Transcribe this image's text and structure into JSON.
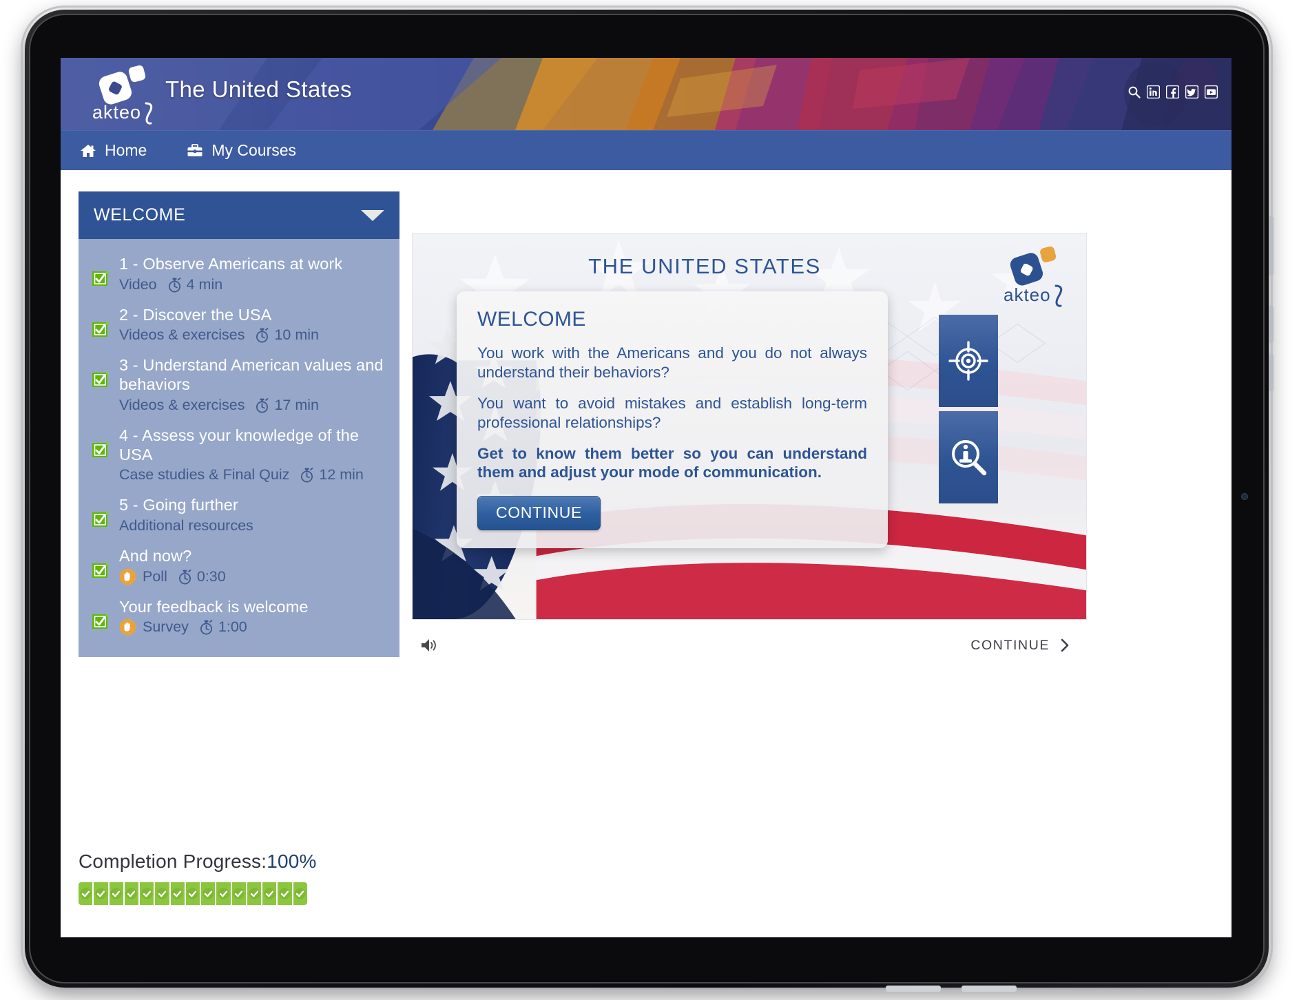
{
  "header": {
    "title": "The United States",
    "brand": "akteos",
    "social": [
      {
        "name": "search-icon",
        "label": "Search"
      },
      {
        "name": "linkedin-icon",
        "label": "LinkedIn"
      },
      {
        "name": "facebook-icon",
        "label": "Facebook"
      },
      {
        "name": "twitter-icon",
        "label": "Twitter"
      },
      {
        "name": "youtube-icon",
        "label": "YouTube"
      }
    ]
  },
  "nav": {
    "items": [
      {
        "label": "Home",
        "icon": "home-icon"
      },
      {
        "label": "My Courses",
        "icon": "briefcase-icon"
      }
    ]
  },
  "sidebar": {
    "section_title": "WELCOME",
    "caret": "chevron-down-icon",
    "items": [
      {
        "name": "1 - Observe Americans at work",
        "type": "Video",
        "duration": "4 min",
        "status": "completed",
        "badge": null
      },
      {
        "name": "2 - Discover the USA",
        "type": "Videos & exercises",
        "duration": "10 min",
        "status": "completed",
        "badge": null
      },
      {
        "name": "3 - Understand American values and behaviors",
        "type": "Videos & exercises",
        "duration": "17 min",
        "status": "completed",
        "badge": null
      },
      {
        "name": "4 - Assess your knowledge of the USA",
        "type": "Case studies & Final Quiz",
        "duration": "12 min",
        "status": "completed",
        "badge": null
      },
      {
        "name": "5 - Going further",
        "type": "Additional resources",
        "duration": "",
        "status": "completed",
        "badge": null
      },
      {
        "name": "And now?",
        "type": "Poll",
        "duration": "0:30",
        "status": "completed",
        "badge": "hand-icon"
      },
      {
        "name": "Your feedback is welcome",
        "type": "Survey",
        "duration": "1:00",
        "status": "completed",
        "badge": "hand-icon"
      }
    ]
  },
  "slide": {
    "title": "THE UNITED STATES",
    "logo": "akteos",
    "panels": [
      {
        "name": "objectives-panel",
        "icon": "target-icon"
      },
      {
        "name": "information-panel",
        "icon": "info-magnifier-icon"
      }
    ],
    "dialog": {
      "title": "WELCOME",
      "paragraph_1": "You work with the Americans and you do not always understand their behaviors?",
      "paragraph_2": "You want to avoid mistakes and establish long-term professional relationships?",
      "paragraph_3": "Get to know them better so you can understand them and adjust your mode of communication.",
      "button_label": "CONTINUE"
    }
  },
  "player": {
    "sound_icon": "speaker-icon",
    "continue_label": "CONTINUE",
    "chevron": "chevron-right-icon"
  },
  "progress": {
    "label": "Completion Progress:",
    "percent": "100%",
    "segments": 15,
    "segment_state": "checked",
    "color": "#8cc63f"
  },
  "colors": {
    "banner_blue": "#3b4a8f",
    "nav_blue": "#3c5ba0",
    "sidebar_header": "#2f5395",
    "sidebar_body": "#97a7c9",
    "accent_text": "#2e5596",
    "progress_green": "#8cc63f",
    "badge_orange": "#e8a33d"
  }
}
